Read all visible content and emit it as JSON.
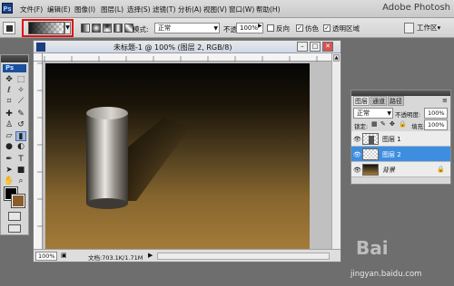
{
  "app": {
    "title": "Adobe Photosh",
    "icon": "ps-app-icon"
  },
  "menu": [
    "文件(F)",
    "编辑(E)",
    "图像(I)",
    "图层(L)",
    "选择(S)",
    "滤镜(T)",
    "分析(A)",
    "视图(V)",
    "窗口(W)",
    "帮助(H)"
  ],
  "options": {
    "mode_label": "模式:",
    "mode_value": "正常",
    "opacity_label": "不透明度:",
    "opacity_value": "100%",
    "reverse_label": "反向",
    "dither_label": "仿色",
    "transparency_label": "透明区域",
    "reverse_checked": false,
    "dither_checked": true,
    "transparency_checked": true,
    "workspace_label": "工作区▾",
    "gradient_icon": "gradient-picker-icon"
  },
  "toolbox": {
    "logo": "Ps",
    "foreground_color": "#000000",
    "background_color": "#8a5e2a"
  },
  "document": {
    "title": "未标题-1 @ 100% (图层 2, RGB/8)",
    "zoom": "100%",
    "info": "文档:703.1K/1.71M"
  },
  "layers_panel": {
    "tabs": [
      "图层",
      "通道",
      "路径"
    ],
    "blend_mode": "正常",
    "opacity_label": "不透明度:",
    "opacity_value": "100%",
    "lock_label": "锁定:",
    "fill_label": "填充:",
    "fill_value": "100%",
    "layers": [
      {
        "name": "图层 1",
        "selected": false,
        "locked": false
      },
      {
        "name": "图层 2",
        "selected": true,
        "locked": false
      },
      {
        "name": "背景",
        "selected": false,
        "locked": true
      }
    ]
  },
  "watermark": {
    "logo": "Bai",
    "url": "jingyan.baidu.com"
  }
}
